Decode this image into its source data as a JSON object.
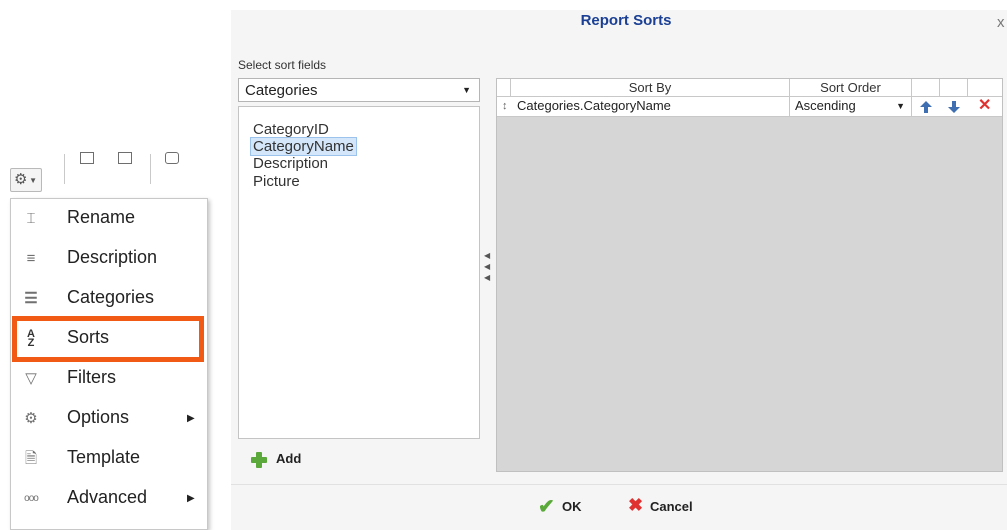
{
  "context_menu": {
    "items": [
      {
        "label": "Rename",
        "icon": "rename-icon",
        "has_submenu": false
      },
      {
        "label": "Description",
        "icon": "description-icon",
        "has_submenu": false
      },
      {
        "label": "Categories",
        "icon": "categories-icon",
        "has_submenu": false
      },
      {
        "label": "Sorts",
        "icon": "sort-az-icon",
        "has_submenu": false,
        "highlighted": true
      },
      {
        "label": "Filters",
        "icon": "filter-icon",
        "has_submenu": false
      },
      {
        "label": "Options",
        "icon": "gear-icon",
        "has_submenu": true
      },
      {
        "label": "Template",
        "icon": "template-icon",
        "has_submenu": false
      },
      {
        "label": "Advanced",
        "icon": "advanced-icon",
        "has_submenu": true
      }
    ],
    "highlight_color": "#f05a14"
  },
  "dialog": {
    "title": "Report Sorts",
    "close_glyph": "x",
    "select_label": "Select sort fields",
    "table_select": {
      "value": "Categories"
    },
    "fields": [
      "CategoryID",
      "CategoryName",
      "Description",
      "Picture"
    ],
    "selected_field": "CategoryName",
    "add_label": "Add",
    "grid": {
      "headers": {
        "sort_by": "Sort By",
        "sort_order": "Sort Order"
      },
      "rows": [
        {
          "sort_by": "Categories.CategoryName",
          "sort_order": "Ascending"
        }
      ]
    },
    "ok_label": "OK",
    "cancel_label": "Cancel",
    "colors": {
      "title": "#1a3f94",
      "accent_green": "#5aa93a",
      "delete_red": "#e03131",
      "selection": "#d3e6fa"
    }
  }
}
